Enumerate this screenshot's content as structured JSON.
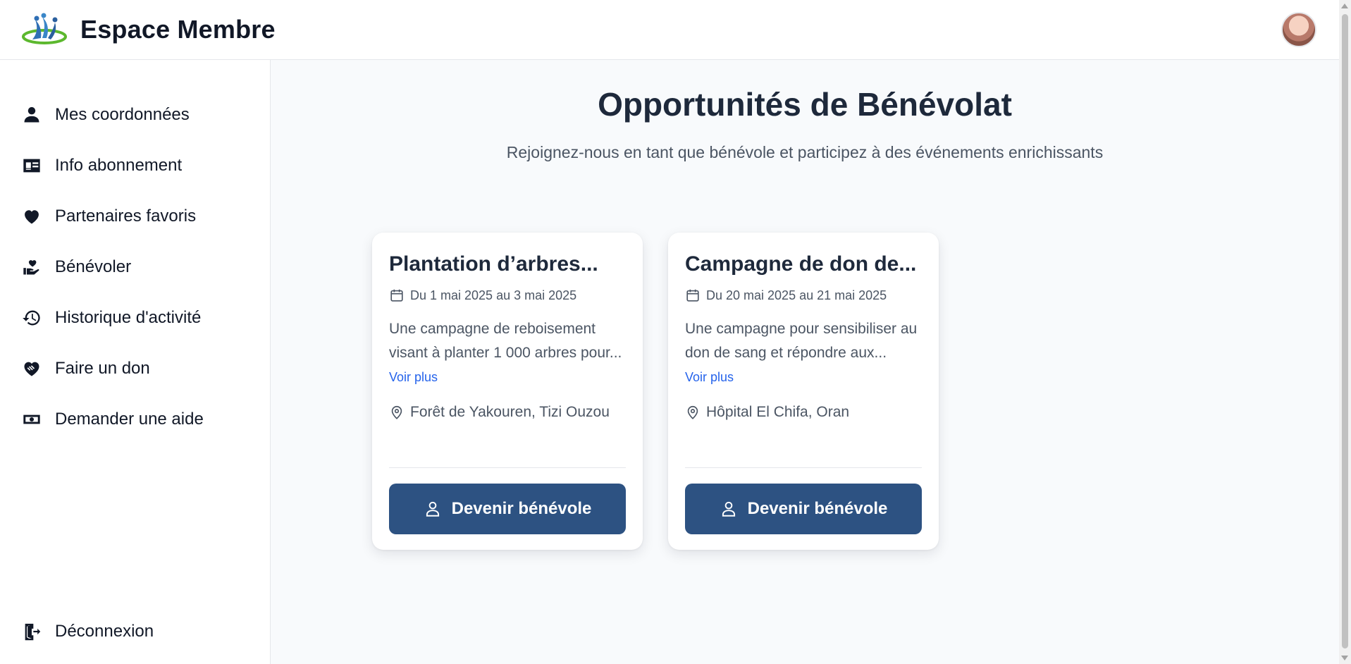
{
  "header": {
    "title": "Espace Membre",
    "logo_icon": "members-logo-icon",
    "avatar_icon": "user-avatar"
  },
  "sidebar": {
    "items": [
      {
        "label": "Mes coordonnées",
        "icon": "person-icon"
      },
      {
        "label": "Info abonnement",
        "icon": "id-card-icon"
      },
      {
        "label": "Partenaires favoris",
        "icon": "heart-icon"
      },
      {
        "label": "Bénévoler",
        "icon": "hand-heart-icon"
      },
      {
        "label": "Historique d'activité",
        "icon": "history-icon"
      },
      {
        "label": "Faire un don",
        "icon": "handshake-heart-icon"
      },
      {
        "label": "Demander une aide",
        "icon": "money-icon"
      }
    ],
    "logout": {
      "label": "Déconnexion",
      "icon": "logout-icon"
    }
  },
  "main": {
    "title": "Opportunités de Bénévolat",
    "subtitle": "Rejoignez-nous en tant que bénévole et participez à des événements enrichissants",
    "cards": [
      {
        "title": "Plantation d’arbres...",
        "date": "Du 1 mai 2025 au 3 mai 2025",
        "description": "Une campagne de reboisement visant à planter 1 000 arbres pour...",
        "more_label": "Voir plus",
        "location": "Forêt de Yakouren, Tizi Ouzou",
        "button_label": "Devenir bénévole"
      },
      {
        "title": "Campagne de don de...",
        "date": "Du 20 mai 2025 au 21 mai 2025",
        "description": "Une campagne pour sensibiliser au don de sang et répondre aux...",
        "more_label": "Voir plus",
        "location": "Hôpital El Chifa, Oran",
        "button_label": "Devenir bénévole"
      }
    ]
  },
  "colors": {
    "primary_button": "#2d5282",
    "link": "#2563eb",
    "main_background": "#f8fafc",
    "title_text": "#1e293b"
  }
}
